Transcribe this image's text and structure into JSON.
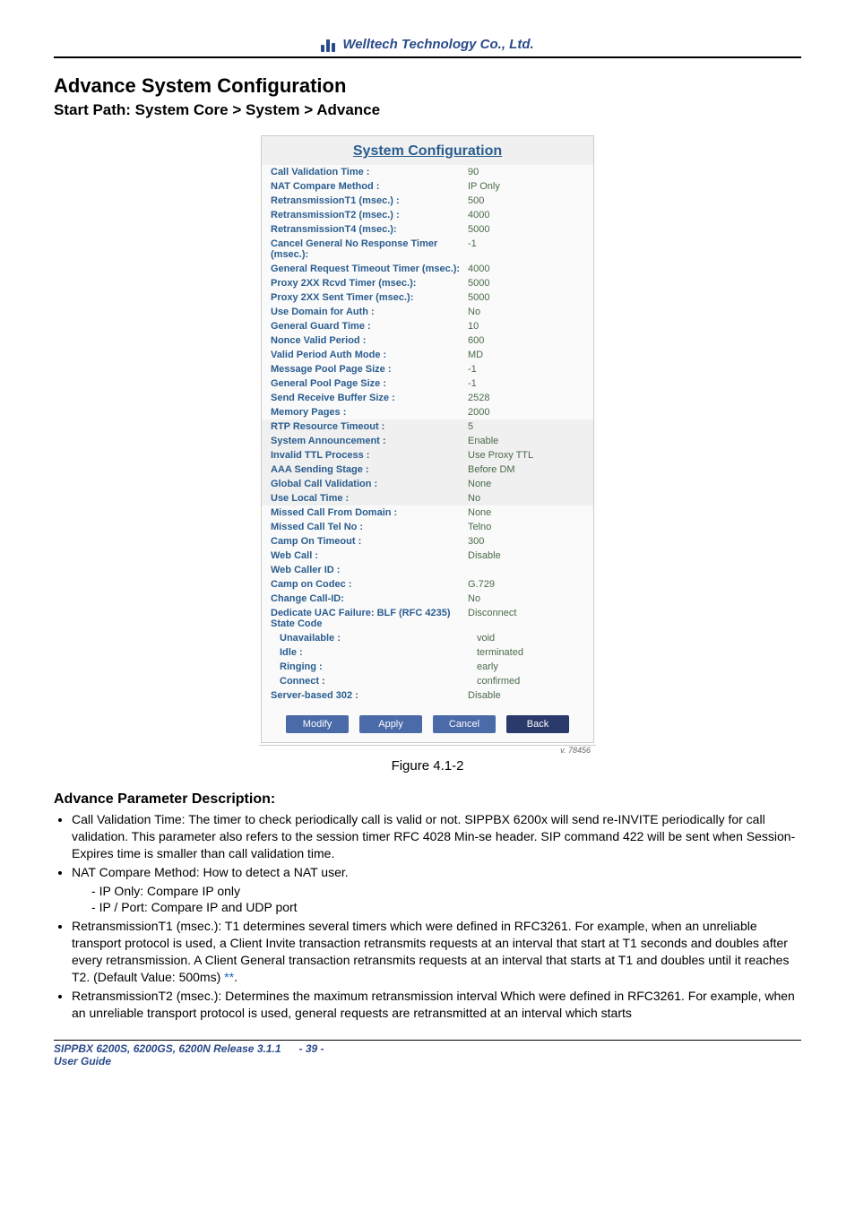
{
  "header": {
    "company": "Welltech Technology Co., Ltd."
  },
  "section": {
    "title": "Advance System Configuration",
    "startPath": "Start Path: System Core > System > Advance"
  },
  "configPanel": {
    "title": "System Configuration",
    "rows": [
      {
        "label": "Call Validation Time :",
        "value": "90",
        "alt": false
      },
      {
        "label": "NAT Compare Method :",
        "value": "IP Only",
        "alt": false
      },
      {
        "label": "RetransmissionT1 (msec.) :",
        "value": "500",
        "alt": false
      },
      {
        "label": "RetransmissionT2 (msec.) :",
        "value": "4000",
        "alt": false
      },
      {
        "label": "RetransmissionT4 (msec.):",
        "value": "5000",
        "alt": false
      },
      {
        "label": "Cancel General No Response Timer (msec.):",
        "value": "-1",
        "alt": false
      },
      {
        "label": "General Request Timeout Timer (msec.):",
        "value": "4000",
        "alt": false
      },
      {
        "label": "Proxy 2XX Rcvd Timer (msec.):",
        "value": "5000",
        "alt": false
      },
      {
        "label": "Proxy 2XX Sent Timer (msec.):",
        "value": "5000",
        "alt": false
      },
      {
        "label": "Use Domain for Auth :",
        "value": "No",
        "alt": false
      },
      {
        "label": "General Guard Time :",
        "value": "10",
        "alt": false
      },
      {
        "label": "Nonce Valid Period :",
        "value": "600",
        "alt": false
      },
      {
        "label": "Valid Period Auth Mode :",
        "value": "MD",
        "alt": false
      },
      {
        "label": "Message Pool Page Size :",
        "value": "-1",
        "alt": false
      },
      {
        "label": "General Pool Page Size :",
        "value": "-1",
        "alt": false
      },
      {
        "label": "Send Receive Buffer Size :",
        "value": "2528",
        "alt": false
      },
      {
        "label": "Memory Pages :",
        "value": "2000",
        "alt": false
      },
      {
        "label": "RTP Resource Timeout :",
        "value": "5",
        "alt": true
      },
      {
        "label": "System Announcement :",
        "value": "Enable",
        "alt": true
      },
      {
        "label": "Invalid TTL Process :",
        "value": "Use Proxy TTL",
        "alt": true
      },
      {
        "label": "AAA Sending Stage :",
        "value": "Before DM",
        "alt": true
      },
      {
        "label": "Global Call Validation :",
        "value": "None",
        "alt": true
      },
      {
        "label": "Use Local Time :",
        "value": "No",
        "alt": true
      },
      {
        "label": "Missed Call From Domain :",
        "value": "None",
        "alt": false
      },
      {
        "label": "Missed Call Tel No :",
        "value": "Telno",
        "alt": false
      },
      {
        "label": "Camp On Timeout :",
        "value": "300",
        "alt": false
      },
      {
        "label": "Web Call :",
        "value": "Disable",
        "alt": false
      },
      {
        "label": "Web Caller ID :",
        "value": "",
        "alt": false
      },
      {
        "label": "Camp on Codec :",
        "value": "G.729",
        "alt": false
      },
      {
        "label": "Change Call-ID:",
        "value": "No",
        "alt": false
      },
      {
        "label": "Dedicate UAC Failure:\nBLF (RFC 4235) State Code",
        "value": "Disconnect",
        "alt": false
      },
      {
        "label": "Unavailable :",
        "value": "void",
        "alt": false,
        "indent": true
      },
      {
        "label": "Idle :",
        "value": "terminated",
        "alt": false,
        "indent": true
      },
      {
        "label": "Ringing :",
        "value": "early",
        "alt": false,
        "indent": true
      },
      {
        "label": "Connect :",
        "value": "confirmed",
        "alt": false,
        "indent": true
      },
      {
        "label": "Server-based 302 :",
        "value": "Disable",
        "alt": false
      }
    ],
    "buttons": {
      "modify": "Modify",
      "apply": "Apply",
      "cancel": "Cancel",
      "back": "Back"
    },
    "version": "v. 78456"
  },
  "figureCaption": "Figure 4.1-2",
  "description": {
    "title": "Advance Parameter Description:",
    "bullets": {
      "b1": "Call Validation Time: The timer to check periodically call is valid or not. SIPPBX 6200x will send re-INVITE periodically for call validation. This parameter also refers to the session timer RFC 4028 Min-se header. SIP command 422 will be sent when Session-Expires time is smaller than call validation time.",
      "b2": "NAT Compare Method: How to detect a NAT user.",
      "b2s1": "IP Only: Compare IP only",
      "b2s2": "IP / Port: Compare IP and UDP port",
      "b3a": "RetransmissionT1 (msec.): T1 determines several timers which were defined in RFC3261. For example, when an unreliable transport protocol is used, a Client Invite transaction retransmits requests at an interval that start at T1 seconds and doubles after every retransmission. A Client General transaction retransmits requests at an interval that starts at T1 and doubles until it reaches T2. (Default Value: 500ms) ",
      "b3star": "**",
      "b3b": ".",
      "b4": "RetransmissionT2 (msec.): Determines the maximum retransmission interval Which were defined in RFC3261. For example, when an unreliable transport protocol is used, general requests are retransmitted at an interval which starts"
    }
  },
  "footer": {
    "left1": "SIPPBX 6200S, 6200GS, 6200N   Release 3.1.1",
    "left2": "User Guide",
    "pageNum": "- 39 -"
  }
}
